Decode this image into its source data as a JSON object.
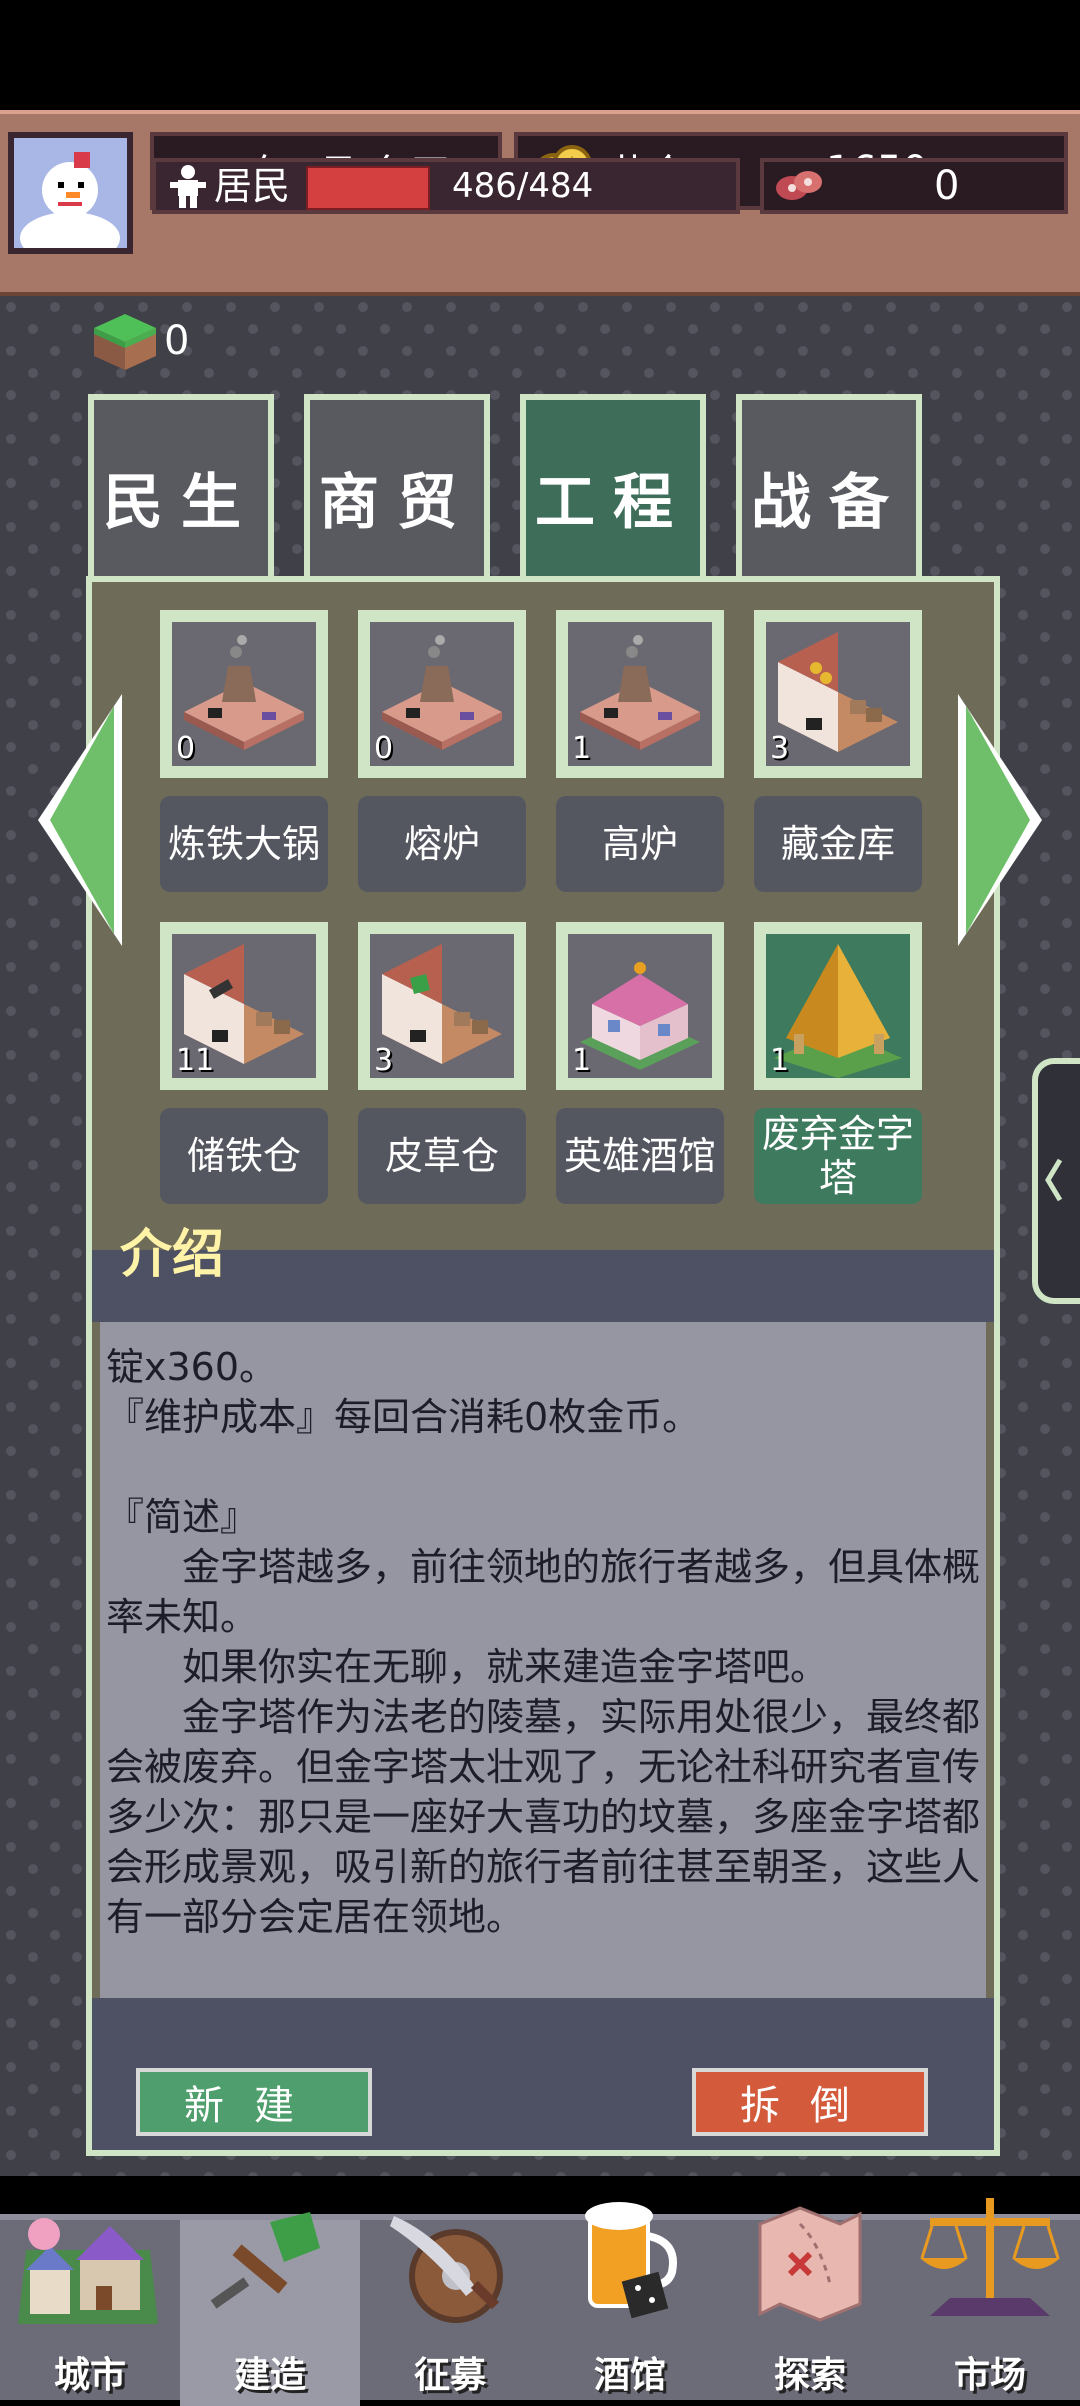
{
  "status": {
    "date": "51年1月 冬天",
    "gold_label": "黄金",
    "gold_value": "1650",
    "resident_label": "居民",
    "resident_value": "486/484",
    "resident_fill_fraction": 1.0,
    "meat_value": "0",
    "grass_count": "0"
  },
  "tabs": [
    {
      "label": "民生",
      "active": false
    },
    {
      "label": "商贸",
      "active": false
    },
    {
      "label": "工程",
      "active": true
    },
    {
      "label": "战备",
      "active": false
    }
  ],
  "buildings": [
    {
      "name": "炼铁大锅",
      "count": "0",
      "icon": "furnace-icon"
    },
    {
      "name": "熔炉",
      "count": "0",
      "icon": "furnace-icon"
    },
    {
      "name": "高炉",
      "count": "1",
      "icon": "furnace-icon"
    },
    {
      "name": "藏金库",
      "count": "3",
      "icon": "vault-icon"
    },
    {
      "name": "储铁仓",
      "count": "11",
      "icon": "warehouse-icon"
    },
    {
      "name": "皮草仓",
      "count": "3",
      "icon": "warehouse-icon"
    },
    {
      "name": "英雄酒馆",
      "count": "1",
      "icon": "tavern-icon"
    },
    {
      "name": "废弃金字塔",
      "count": "1",
      "icon": "pyramid-icon",
      "selected": true
    }
  ],
  "intro": {
    "title": "介绍",
    "description": "锭x360。\n『维护成本』每回合消耗0枚金币。\n\n『简述』\n　　金字塔越多，前往领地的旅行者越多，但具体概率未知。\n　　如果你实在无聊，就来建造金字塔吧。\n　　金字塔作为法老的陵墓，实际用处很少，最终都会被废弃。但金字塔太壮观了，无论社科研究者宣传多少次：那只是一座好大喜功的坟墓，多座金字塔都会形成景观，吸引新的旅行者前往甚至朝圣，这些人有一部分会定居在领地。"
  },
  "actions": {
    "build_label": "新建",
    "demolish_label": "拆倒"
  },
  "nav": [
    {
      "label": "城市",
      "icon": "city-icon"
    },
    {
      "label": "建造",
      "icon": "shovel-icon",
      "active": true
    },
    {
      "label": "征募",
      "icon": "sword-shield-icon"
    },
    {
      "label": "酒馆",
      "icon": "beer-icon"
    },
    {
      "label": "探索",
      "icon": "map-icon"
    },
    {
      "label": "市场",
      "icon": "scale-icon"
    }
  ],
  "colors": {
    "accent_green": "#3e7a5e",
    "build_button": "#4f9e6e",
    "demolish_button": "#d45a3c",
    "resident_bar": "#d44040"
  }
}
